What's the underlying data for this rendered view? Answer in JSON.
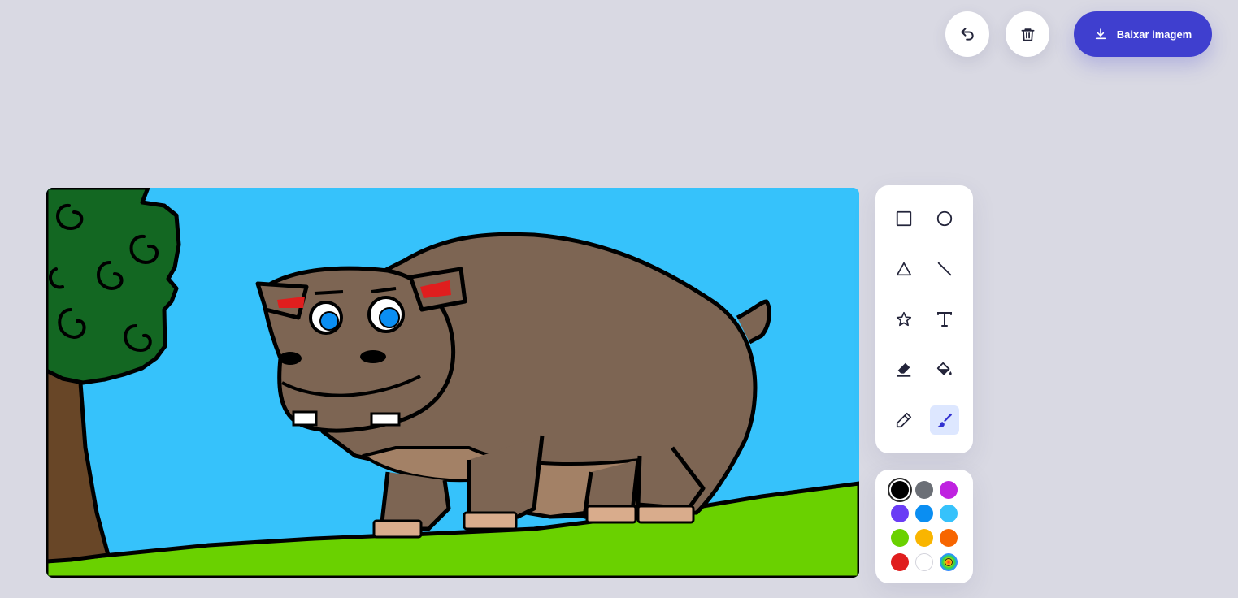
{
  "toolbar": {
    "undo_icon": "undo-icon",
    "clear_icon": "trash-icon",
    "download_label": "Baixar imagem",
    "download_icon": "download-icon"
  },
  "tools": [
    {
      "name": "rectangle",
      "icon": "square-icon",
      "active": false
    },
    {
      "name": "circle",
      "icon": "circle-icon",
      "active": false
    },
    {
      "name": "triangle",
      "icon": "triangle-icon",
      "active": false
    },
    {
      "name": "line",
      "icon": "line-icon",
      "active": false
    },
    {
      "name": "star",
      "icon": "star-icon",
      "active": false
    },
    {
      "name": "text",
      "icon": "text-icon",
      "active": false
    },
    {
      "name": "eraser",
      "icon": "eraser-icon",
      "active": false
    },
    {
      "name": "fill",
      "icon": "paint-bucket-icon",
      "active": false
    },
    {
      "name": "pencil",
      "icon": "pencil-icon",
      "active": false
    },
    {
      "name": "brush",
      "icon": "brush-icon",
      "active": true
    }
  ],
  "colors": [
    "#000000",
    "#6b6f76",
    "#bf22e0",
    "#6a3cf5",
    "#0a8ef2",
    "#36c2fb",
    "#6ad100",
    "#f9b500",
    "#f76500",
    "#e01e1e",
    "#ffffff",
    "color-picker"
  ],
  "selected_color": "#000000",
  "theme": {
    "background": "#d9d9e3",
    "accent": "#3f3fcf",
    "tool_active_bg": "#dde7ff"
  }
}
